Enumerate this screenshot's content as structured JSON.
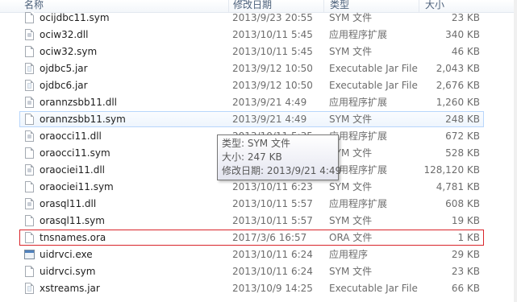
{
  "header": {
    "name": "名称",
    "date": "修改日期",
    "type": "类型",
    "size": "大小"
  },
  "files": [
    {
      "name": "ocijdbc11.sym",
      "date": "2013/9/23 20:55",
      "type": "SYM 文件",
      "size": "23 KB",
      "icon": "file-icon"
    },
    {
      "name": "ociw32.dll",
      "date": "2013/10/11 5:45",
      "type": "应用程序扩展",
      "size": "340 KB",
      "icon": "dll-icon"
    },
    {
      "name": "ociw32.sym",
      "date": "2013/10/11 5:45",
      "type": "SYM 文件",
      "size": "46 KB",
      "icon": "file-icon"
    },
    {
      "name": "ojdbc5.jar",
      "date": "2013/9/12 10:50",
      "type": "Executable Jar File",
      "size": "2,043 KB",
      "icon": "jar-icon"
    },
    {
      "name": "ojdbc6.jar",
      "date": "2013/9/12 10:50",
      "type": "Executable Jar File",
      "size": "2,676 KB",
      "icon": "jar-icon"
    },
    {
      "name": "orannzsbb11.dll",
      "date": "2013/9/21 4:49",
      "type": "应用程序扩展",
      "size": "1,260 KB",
      "icon": "dll-icon"
    },
    {
      "name": "orannzsbb11.sym",
      "date": "2013/9/21 4:49",
      "type": "SYM 文件",
      "size": "248 KB",
      "icon": "file-icon",
      "state": "hover"
    },
    {
      "name": "oraocci11.dll",
      "date": "2013/10/11 5:35",
      "type": "应用程序扩展",
      "size": "672 KB",
      "icon": "dll-icon"
    },
    {
      "name": "oraocci11.sym",
      "date": "2013/10/11 5:35",
      "type": "SYM 文件",
      "size": "528 KB",
      "icon": "file-icon"
    },
    {
      "name": "oraociei11.dll",
      "date": "2013/10/11 6:23",
      "type": "应用程序扩展",
      "size": "128,120 KB",
      "icon": "dll-icon"
    },
    {
      "name": "oraociei11.sym",
      "date": "2013/10/11 6:23",
      "type": "SYM 文件",
      "size": "4,781 KB",
      "icon": "file-icon"
    },
    {
      "name": "orasql11.dll",
      "date": "2013/10/11 5:57",
      "type": "应用程序扩展",
      "size": "608 KB",
      "icon": "dll-icon"
    },
    {
      "name": "orasql11.sym",
      "date": "2013/10/11 5:57",
      "type": "SYM 文件",
      "size": "19 KB",
      "icon": "file-icon"
    },
    {
      "name": "tnsnames.ora",
      "date": "2017/3/6 16:57",
      "type": "ORA 文件",
      "size": "1 KB",
      "icon": "file-icon",
      "state": "boxed"
    },
    {
      "name": "uidrvci.exe",
      "date": "2013/10/11 6:24",
      "type": "应用程序",
      "size": "29 KB",
      "icon": "exe-icon"
    },
    {
      "name": "uidrvci.sym",
      "date": "2013/10/11 6:24",
      "type": "SYM 文件",
      "size": "23 KB",
      "icon": "file-icon"
    },
    {
      "name": "xstreams.jar",
      "date": "2013/10/9 14:25",
      "type": "Executable Jar File",
      "size": "66 KB",
      "icon": "jar-icon"
    }
  ],
  "tooltip": {
    "type_line": "类型: SYM 文件",
    "size_line": "大小: 247 KB",
    "date_line": "修改日期: 2013/9/21 4:49"
  }
}
